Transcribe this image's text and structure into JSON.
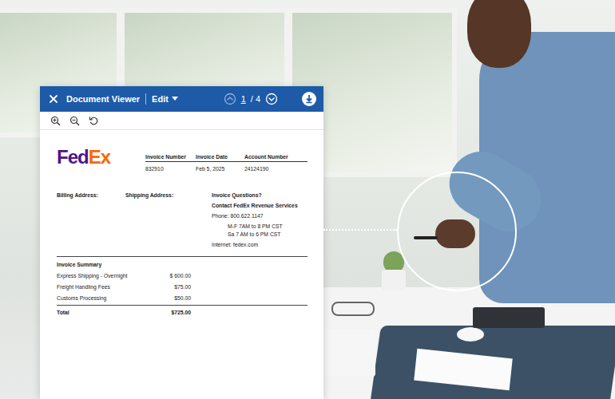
{
  "viewer": {
    "title": "Document Viewer",
    "edit": "Edit",
    "page": "1",
    "page_total": "/ 4"
  },
  "invoice": {
    "logo": {
      "fed": "Fed",
      "ex": "Ex"
    },
    "meta": {
      "columns": [
        "Invoice Number",
        "Invoice Date",
        "Account Number"
      ],
      "values": [
        "832910",
        "Feb 5, 2025",
        "24124190"
      ]
    },
    "addresses": {
      "billing": "Billing Address:",
      "shipping": "Shipping Address:"
    },
    "questions": {
      "title": "Invoice Questions?",
      "contact": "Contact FedEx Revenue Services",
      "phone": "Phone: 800.622.1147",
      "hours": [
        "M-F 7AM to 8 PM CST",
        "Sa 7 AM to 6 PM CST"
      ],
      "internet": "Internet: fedex.com"
    },
    "summary": {
      "title": "Invoice Summary",
      "rows": [
        {
          "label": "Express Shipping - Overnight",
          "amount": "$ 600.00"
        },
        {
          "label": "Freight Handling Fees",
          "amount": "$75.00"
        },
        {
          "label": "Customs Processing",
          "amount": "$50.00"
        }
      ],
      "total": {
        "label": "Total",
        "amount": "$725.00"
      }
    }
  }
}
